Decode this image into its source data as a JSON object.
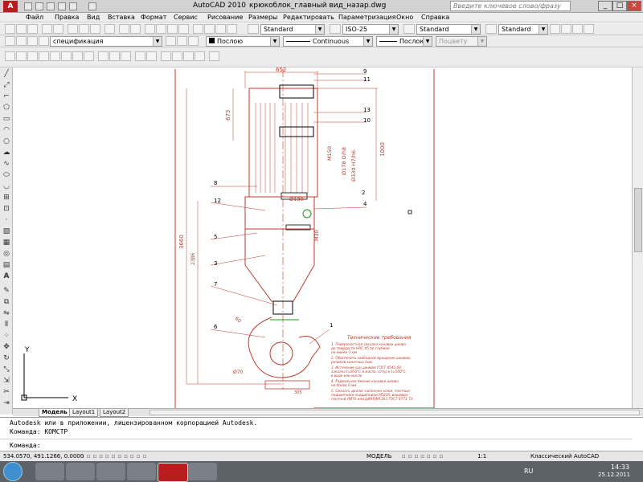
{
  "titlebar": {
    "app_name": "AutoCAD 2010",
    "document": "крюкоблок_главный вид_назар.dwg",
    "search_placeholder": "Введите ключевое слово/фразу",
    "min": "_",
    "max": "□",
    "close": "×"
  },
  "menu": [
    "Файл",
    "Правка",
    "Вид",
    "Вставка",
    "Формат",
    "Сервис",
    "Рисование",
    "Размеры",
    "Редактировать",
    "Параметризация",
    "Окно",
    "Справка"
  ],
  "toolbar_styles": {
    "text_style": "Standard",
    "dim_style": "ISO-25",
    "table_style": "Standard",
    "multileader_style": "Standard"
  },
  "toolbar_layers": {
    "layer_name": "спецификация",
    "color": "Послою",
    "linetype": "Continuous",
    "lineweight": "Послою",
    "plotstyle": "Поцвету"
  },
  "tabs": [
    "Модель",
    "Layout1",
    "Layout2"
  ],
  "command": {
    "line1": "Autodesk или в приложении, лицензированном корпорацией Autodesk.",
    "line2": "Команда: КОМСТР",
    "line3": "Команда:"
  },
  "status": {
    "coords": "534.0570, 491.1266, 0.0000",
    "model": "МОДЕЛЬ",
    "scale": "1:1",
    "workspace": "Классический AutoCAD"
  },
  "tray": {
    "lang": "RU",
    "time": "14:33",
    "date": "25.12.2011"
  },
  "drawing": {
    "dims": {
      "d652": "652",
      "d673": "673",
      "d1000": "1000",
      "d3660": "3660",
      "d2386": "2386",
      "dM150": "M150",
      "d178": "Ø178 D/h8",
      "d330": "Ø330 H7/h6",
      "d130": "Ø130",
      "dM30": "M30",
      "d670": "Ø70",
      "dd60": "60",
      "d305": "305",
      "d1": "1"
    },
    "callouts": [
      "9",
      "11",
      "13",
      "10",
      "8",
      "12",
      "4",
      "5",
      "3",
      "7",
      "6",
      "1",
      "2"
    ],
    "notes_title": "Технические требования",
    "notes": [
      "1. Поверхностная закалка конавки шкива",
      "до твердости НRC 45 по глубине",
      "не менее 3 мм",
      "2. Обеспечить свободное вращение шкивов,",
      "роликов канатных пом.",
      "3. Истечение осн шкивов ГОСТ 4543-69",
      "закалка t=850°С в масло, отпуск t=500°С",
      "в воде или масло",
      "4. Радиальное биение канавки шкива",
      "не более 0 мм",
      "5. Смазать диалог наполнен кожи, плотные",
      "подшипники подшипники АП226, вещевых",
      "плотной ЛИТА или ЦИАТИМ 203 ГОСТ 8773-73"
    ]
  },
  "ucs": {
    "x": "X",
    "y": "Y"
  },
  "colors": {
    "accent_red": "#c0392b",
    "drawing_red": "#e0271f",
    "construction_green": "#14a014"
  }
}
